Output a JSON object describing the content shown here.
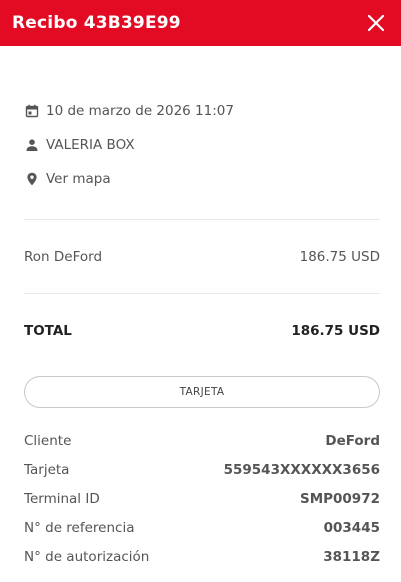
{
  "header": {
    "title": "Recibo 43B39E99",
    "close_icon": "close-icon",
    "color": "#e30b24"
  },
  "meta": {
    "date": "10 de marzo de 2026 11:07",
    "date_icon": "calendar-icon",
    "user": "VALERIA BOX",
    "user_icon": "person-icon",
    "map_link": "Ver mapa",
    "map_icon": "location-pin-icon"
  },
  "items": [
    {
      "name": "Ron DeFord",
      "amount": "186.75 USD"
    }
  ],
  "total": {
    "label": "TOTAL",
    "amount": "186.75 USD"
  },
  "payment_button": "TARJETA",
  "details": [
    {
      "label": "Cliente",
      "value": "DeFord"
    },
    {
      "label": "Tarjeta",
      "value": "559543XXXXXX3656"
    },
    {
      "label": "Terminal ID",
      "value": "SMP00972"
    },
    {
      "label": "N° de referencia",
      "value": "003445"
    },
    {
      "label": "N° de autorización",
      "value": "38118Z"
    }
  ]
}
